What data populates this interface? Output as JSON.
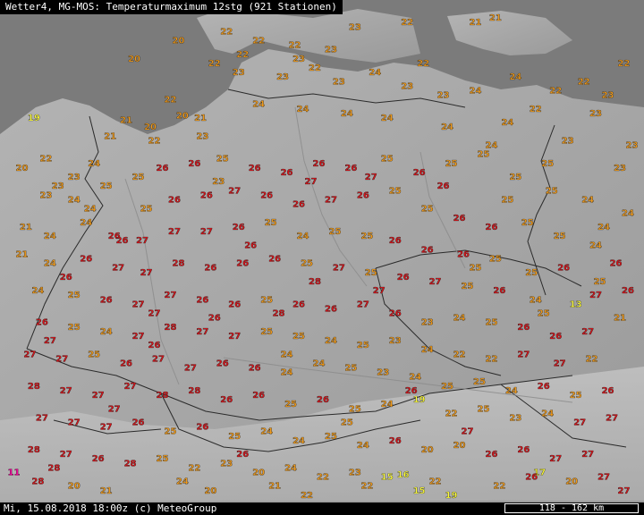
{
  "header": {
    "title": "Wetter4, MG-MOS: Temperaturmaximum 12stg (921 Stationen)"
  },
  "footer": {
    "timestamp": "Mi, 15.08.2018 18:00z (c) MeteoGroup",
    "scale": "118 - 162 km"
  },
  "colors": {
    "sea": "#7b7b7b",
    "land": "#a9a9a9",
    "border": "#2a2a2a",
    "river": "#8a8a8a",
    "temp_red": "#d8141a",
    "temp_orange": "#f09a1a",
    "temp_yellow": "#ffff3a",
    "temp_magenta": "#ff00a0"
  },
  "stations": [
    {
      "v": "20",
      "x": 8.2,
      "y": 55.3
    },
    {
      "v": "20",
      "x": 7.1,
      "y": 54.9
    },
    {
      "v": "19",
      "x": 4.6,
      "y": 53.6
    },
    {
      "v": "21",
      "x": 6.9,
      "y": 53.55
    },
    {
      "v": "20",
      "x": 7.5,
      "y": 53.4
    },
    {
      "v": "20",
      "x": 8.3,
      "y": 53.65
    },
    {
      "v": "21",
      "x": 8.75,
      "y": 53.6
    },
    {
      "v": "22",
      "x": 9.4,
      "y": 55.5
    },
    {
      "v": "22",
      "x": 10.2,
      "y": 55.3
    },
    {
      "v": "22",
      "x": 11.1,
      "y": 55.2
    },
    {
      "v": "23",
      "x": 12.0,
      "y": 55.1
    },
    {
      "v": "23",
      "x": 12.6,
      "y": 55.6
    },
    {
      "v": "22",
      "x": 13.9,
      "y": 55.7
    },
    {
      "v": "21",
      "x": 15.6,
      "y": 55.7
    },
    {
      "v": "21",
      "x": 16.1,
      "y": 55.8
    },
    {
      "v": "22",
      "x": 9.1,
      "y": 54.8
    },
    {
      "v": "23",
      "x": 9.7,
      "y": 54.6
    },
    {
      "v": "23",
      "x": 10.8,
      "y": 54.5
    },
    {
      "v": "22",
      "x": 11.6,
      "y": 54.7
    },
    {
      "v": "23",
      "x": 12.2,
      "y": 54.4
    },
    {
      "v": "24",
      "x": 13.1,
      "y": 54.6
    },
    {
      "v": "23",
      "x": 13.9,
      "y": 54.3
    },
    {
      "v": "23",
      "x": 14.8,
      "y": 54.1
    },
    {
      "v": "24",
      "x": 15.6,
      "y": 54.2
    },
    {
      "v": "24",
      "x": 16.6,
      "y": 54.5
    },
    {
      "v": "22",
      "x": 17.6,
      "y": 54.2
    },
    {
      "v": "22",
      "x": 18.3,
      "y": 54.4
    },
    {
      "v": "23",
      "x": 18.9,
      "y": 54.1
    },
    {
      "v": "22",
      "x": 19.3,
      "y": 54.8
    },
    {
      "v": "23",
      "x": 18.6,
      "y": 53.7
    },
    {
      "v": "24",
      "x": 16.4,
      "y": 53.5
    },
    {
      "v": "24",
      "x": 14.9,
      "y": 53.4
    },
    {
      "v": "24",
      "x": 13.4,
      "y": 53.6
    },
    {
      "v": "24",
      "x": 12.4,
      "y": 53.7
    },
    {
      "v": "24",
      "x": 11.3,
      "y": 53.8
    },
    {
      "v": "24",
      "x": 10.2,
      "y": 53.9
    },
    {
      "v": "23",
      "x": 8.8,
      "y": 53.2
    },
    {
      "v": "22",
      "x": 7.6,
      "y": 53.1
    },
    {
      "v": "21",
      "x": 6.5,
      "y": 53.2
    },
    {
      "v": "20",
      "x": 4.3,
      "y": 52.5
    },
    {
      "v": "22",
      "x": 4.9,
      "y": 52.7
    },
    {
      "v": "23",
      "x": 5.6,
      "y": 52.3
    },
    {
      "v": "23",
      "x": 5.2,
      "y": 52.1
    },
    {
      "v": "24",
      "x": 6.1,
      "y": 52.6
    },
    {
      "v": "23",
      "x": 4.9,
      "y": 51.9
    },
    {
      "v": "24",
      "x": 5.6,
      "y": 51.8
    },
    {
      "v": "25",
      "x": 6.4,
      "y": 52.1
    },
    {
      "v": "25",
      "x": 7.2,
      "y": 52.3
    },
    {
      "v": "26",
      "x": 7.8,
      "y": 52.5
    },
    {
      "v": "26",
      "x": 8.6,
      "y": 52.6
    },
    {
      "v": "25",
      "x": 9.3,
      "y": 52.7
    },
    {
      "v": "26",
      "x": 10.1,
      "y": 52.5
    },
    {
      "v": "26",
      "x": 10.9,
      "y": 52.4
    },
    {
      "v": "26",
      "x": 11.7,
      "y": 52.6
    },
    {
      "v": "26",
      "x": 12.5,
      "y": 52.5
    },
    {
      "v": "25",
      "x": 13.4,
      "y": 52.7
    },
    {
      "v": "26",
      "x": 14.2,
      "y": 52.4
    },
    {
      "v": "25",
      "x": 15.0,
      "y": 52.6
    },
    {
      "v": "25",
      "x": 15.8,
      "y": 52.8
    },
    {
      "v": "25",
      "x": 16.6,
      "y": 52.3
    },
    {
      "v": "25",
      "x": 17.5,
      "y": 52.0
    },
    {
      "v": "24",
      "x": 18.4,
      "y": 51.8
    },
    {
      "v": "23",
      "x": 19.2,
      "y": 52.5
    },
    {
      "v": "24",
      "x": 19.4,
      "y": 51.5
    },
    {
      "v": "25",
      "x": 7.4,
      "y": 51.6
    },
    {
      "v": "26",
      "x": 8.1,
      "y": 51.8
    },
    {
      "v": "26",
      "x": 8.9,
      "y": 51.9
    },
    {
      "v": "27",
      "x": 9.6,
      "y": 52.0
    },
    {
      "v": "26",
      "x": 10.4,
      "y": 51.9
    },
    {
      "v": "26",
      "x": 11.2,
      "y": 51.7
    },
    {
      "v": "27",
      "x": 12.0,
      "y": 51.8
    },
    {
      "v": "26",
      "x": 12.8,
      "y": 51.9
    },
    {
      "v": "25",
      "x": 13.6,
      "y": 52.0
    },
    {
      "v": "25",
      "x": 14.4,
      "y": 51.6
    },
    {
      "v": "26",
      "x": 15.2,
      "y": 51.4
    },
    {
      "v": "26",
      "x": 16.0,
      "y": 51.2
    },
    {
      "v": "25",
      "x": 16.9,
      "y": 51.3
    },
    {
      "v": "25",
      "x": 17.7,
      "y": 51.0
    },
    {
      "v": "24",
      "x": 18.6,
      "y": 50.8
    },
    {
      "v": "21",
      "x": 4.4,
      "y": 51.2
    },
    {
      "v": "24",
      "x": 5.0,
      "y": 51.0
    },
    {
      "v": "24",
      "x": 5.9,
      "y": 51.3
    },
    {
      "v": "26",
      "x": 6.6,
      "y": 51.0
    },
    {
      "v": "27",
      "x": 7.3,
      "y": 50.9
    },
    {
      "v": "27",
      "x": 8.1,
      "y": 51.1
    },
    {
      "v": "27",
      "x": 8.9,
      "y": 51.1
    },
    {
      "v": "26",
      "x": 9.7,
      "y": 51.2
    },
    {
      "v": "25",
      "x": 10.5,
      "y": 51.3
    },
    {
      "v": "24",
      "x": 11.3,
      "y": 51.0
    },
    {
      "v": "25",
      "x": 12.1,
      "y": 51.1
    },
    {
      "v": "25",
      "x": 12.9,
      "y": 51.0
    },
    {
      "v": "26",
      "x": 13.6,
      "y": 50.9
    },
    {
      "v": "26",
      "x": 14.4,
      "y": 50.7
    },
    {
      "v": "26",
      "x": 15.3,
      "y": 50.6
    },
    {
      "v": "25",
      "x": 16.1,
      "y": 50.5
    },
    {
      "v": "25",
      "x": 17.0,
      "y": 50.2
    },
    {
      "v": "26",
      "x": 17.8,
      "y": 50.3
    },
    {
      "v": "25",
      "x": 18.7,
      "y": 50.0
    },
    {
      "v": "26",
      "x": 19.4,
      "y": 49.8
    },
    {
      "v": "13",
      "x": 18.1,
      "y": 49.5
    },
    {
      "v": "21",
      "x": 4.3,
      "y": 50.6
    },
    {
      "v": "24",
      "x": 5.0,
      "y": 50.4
    },
    {
      "v": "26",
      "x": 5.9,
      "y": 50.5
    },
    {
      "v": "27",
      "x": 6.7,
      "y": 50.3
    },
    {
      "v": "27",
      "x": 7.4,
      "y": 50.2
    },
    {
      "v": "28",
      "x": 8.2,
      "y": 50.4
    },
    {
      "v": "26",
      "x": 9.0,
      "y": 50.3
    },
    {
      "v": "26",
      "x": 9.8,
      "y": 50.4
    },
    {
      "v": "26",
      "x": 10.6,
      "y": 50.5
    },
    {
      "v": "25",
      "x": 11.4,
      "y": 50.4
    },
    {
      "v": "27",
      "x": 12.2,
      "y": 50.3
    },
    {
      "v": "25",
      "x": 13.0,
      "y": 50.2
    },
    {
      "v": "26",
      "x": 13.8,
      "y": 50.1
    },
    {
      "v": "27",
      "x": 14.6,
      "y": 50.0
    },
    {
      "v": "25",
      "x": 15.4,
      "y": 49.9
    },
    {
      "v": "26",
      "x": 16.2,
      "y": 49.8
    },
    {
      "v": "24",
      "x": 17.1,
      "y": 49.6
    },
    {
      "v": "24",
      "x": 4.7,
      "y": 49.8
    },
    {
      "v": "25",
      "x": 5.6,
      "y": 49.7
    },
    {
      "v": "26",
      "x": 6.4,
      "y": 49.6
    },
    {
      "v": "27",
      "x": 7.2,
      "y": 49.5
    },
    {
      "v": "27",
      "x": 8.0,
      "y": 49.7
    },
    {
      "v": "26",
      "x": 8.8,
      "y": 49.6
    },
    {
      "v": "26",
      "x": 9.6,
      "y": 49.5
    },
    {
      "v": "25",
      "x": 10.4,
      "y": 49.6
    },
    {
      "v": "26",
      "x": 11.2,
      "y": 49.5
    },
    {
      "v": "26",
      "x": 12.0,
      "y": 49.4
    },
    {
      "v": "27",
      "x": 12.8,
      "y": 49.5
    },
    {
      "v": "26",
      "x": 13.6,
      "y": 49.3
    },
    {
      "v": "23",
      "x": 14.4,
      "y": 49.1
    },
    {
      "v": "24",
      "x": 15.2,
      "y": 49.2
    },
    {
      "v": "25",
      "x": 16.0,
      "y": 49.1
    },
    {
      "v": "26",
      "x": 16.8,
      "y": 49.0
    },
    {
      "v": "26",
      "x": 17.6,
      "y": 48.8
    },
    {
      "v": "27",
      "x": 18.4,
      "y": 48.9
    },
    {
      "v": "21",
      "x": 19.2,
      "y": 49.2
    },
    {
      "v": "26",
      "x": 4.8,
      "y": 49.1
    },
    {
      "v": "25",
      "x": 5.6,
      "y": 49.0
    },
    {
      "v": "24",
      "x": 6.4,
      "y": 48.9
    },
    {
      "v": "27",
      "x": 7.2,
      "y": 48.8
    },
    {
      "v": "28",
      "x": 8.0,
      "y": 49.0
    },
    {
      "v": "27",
      "x": 8.8,
      "y": 48.9
    },
    {
      "v": "27",
      "x": 9.6,
      "y": 48.8
    },
    {
      "v": "25",
      "x": 10.4,
      "y": 48.9
    },
    {
      "v": "25",
      "x": 11.2,
      "y": 48.8
    },
    {
      "v": "24",
      "x": 12.0,
      "y": 48.7
    },
    {
      "v": "25",
      "x": 12.8,
      "y": 48.6
    },
    {
      "v": "23",
      "x": 13.6,
      "y": 48.7
    },
    {
      "v": "24",
      "x": 14.4,
      "y": 48.5
    },
    {
      "v": "22",
      "x": 15.2,
      "y": 48.4
    },
    {
      "v": "22",
      "x": 16.0,
      "y": 48.3
    },
    {
      "v": "27",
      "x": 16.8,
      "y": 48.4
    },
    {
      "v": "27",
      "x": 17.7,
      "y": 48.2
    },
    {
      "v": "22",
      "x": 18.5,
      "y": 48.3
    },
    {
      "v": "27",
      "x": 4.5,
      "y": 48.4
    },
    {
      "v": "27",
      "x": 5.3,
      "y": 48.3
    },
    {
      "v": "25",
      "x": 6.1,
      "y": 48.4
    },
    {
      "v": "26",
      "x": 6.9,
      "y": 48.2
    },
    {
      "v": "27",
      "x": 7.7,
      "y": 48.3
    },
    {
      "v": "27",
      "x": 8.5,
      "y": 48.1
    },
    {
      "v": "26",
      "x": 9.3,
      "y": 48.2
    },
    {
      "v": "26",
      "x": 10.1,
      "y": 48.1
    },
    {
      "v": "24",
      "x": 10.9,
      "y": 48.0
    },
    {
      "v": "24",
      "x": 11.7,
      "y": 48.2
    },
    {
      "v": "25",
      "x": 12.5,
      "y": 48.1
    },
    {
      "v": "23",
      "x": 13.3,
      "y": 48.0
    },
    {
      "v": "24",
      "x": 14.1,
      "y": 47.9
    },
    {
      "v": "25",
      "x": 14.9,
      "y": 47.7
    },
    {
      "v": "25",
      "x": 15.7,
      "y": 47.8
    },
    {
      "v": "24",
      "x": 16.5,
      "y": 47.6
    },
    {
      "v": "26",
      "x": 17.3,
      "y": 47.7
    },
    {
      "v": "25",
      "x": 18.1,
      "y": 47.5
    },
    {
      "v": "26",
      "x": 18.9,
      "y": 47.6
    },
    {
      "v": "28",
      "x": 4.6,
      "y": 47.7
    },
    {
      "v": "27",
      "x": 5.4,
      "y": 47.6
    },
    {
      "v": "27",
      "x": 6.2,
      "y": 47.5
    },
    {
      "v": "27",
      "x": 7.0,
      "y": 47.7
    },
    {
      "v": "28",
      "x": 7.8,
      "y": 47.5
    },
    {
      "v": "28",
      "x": 8.6,
      "y": 47.6
    },
    {
      "v": "26",
      "x": 9.4,
      "y": 47.4
    },
    {
      "v": "26",
      "x": 10.2,
      "y": 47.5
    },
    {
      "v": "25",
      "x": 11.0,
      "y": 47.3
    },
    {
      "v": "26",
      "x": 11.8,
      "y": 47.4
    },
    {
      "v": "25",
      "x": 12.6,
      "y": 47.2
    },
    {
      "v": "24",
      "x": 13.4,
      "y": 47.3
    },
    {
      "v": "19",
      "x": 14.2,
      "y": 47.4
    },
    {
      "v": "22",
      "x": 15.0,
      "y": 47.1
    },
    {
      "v": "25",
      "x": 15.8,
      "y": 47.2
    },
    {
      "v": "23",
      "x": 16.6,
      "y": 47.0
    },
    {
      "v": "24",
      "x": 17.4,
      "y": 47.1
    },
    {
      "v": "27",
      "x": 18.2,
      "y": 46.9
    },
    {
      "v": "27",
      "x": 19.0,
      "y": 47.0
    },
    {
      "v": "27",
      "x": 4.8,
      "y": 47.0
    },
    {
      "v": "27",
      "x": 5.6,
      "y": 46.9
    },
    {
      "v": "27",
      "x": 6.4,
      "y": 46.8
    },
    {
      "v": "26",
      "x": 7.2,
      "y": 46.9
    },
    {
      "v": "25",
      "x": 8.0,
      "y": 46.7
    },
    {
      "v": "26",
      "x": 8.8,
      "y": 46.8
    },
    {
      "v": "25",
      "x": 9.6,
      "y": 46.6
    },
    {
      "v": "24",
      "x": 10.4,
      "y": 46.7
    },
    {
      "v": "24",
      "x": 11.2,
      "y": 46.5
    },
    {
      "v": "25",
      "x": 12.0,
      "y": 46.6
    },
    {
      "v": "24",
      "x": 12.8,
      "y": 46.4
    },
    {
      "v": "26",
      "x": 13.6,
      "y": 46.5
    },
    {
      "v": "20",
      "x": 14.4,
      "y": 46.3
    },
    {
      "v": "20",
      "x": 15.2,
      "y": 46.4
    },
    {
      "v": "26",
      "x": 16.0,
      "y": 46.2
    },
    {
      "v": "26",
      "x": 16.8,
      "y": 46.3
    },
    {
      "v": "27",
      "x": 17.6,
      "y": 46.1
    },
    {
      "v": "27",
      "x": 18.4,
      "y": 46.2
    },
    {
      "v": "28",
      "x": 4.6,
      "y": 46.3
    },
    {
      "v": "27",
      "x": 5.4,
      "y": 46.2
    },
    {
      "v": "26",
      "x": 6.2,
      "y": 46.1
    },
    {
      "v": "28",
      "x": 7.0,
      "y": 46.0
    },
    {
      "v": "25",
      "x": 7.8,
      "y": 46.1
    },
    {
      "v": "22",
      "x": 8.6,
      "y": 45.9
    },
    {
      "v": "23",
      "x": 9.4,
      "y": 46.0
    },
    {
      "v": "20",
      "x": 10.2,
      "y": 45.8
    },
    {
      "v": "24",
      "x": 11.0,
      "y": 45.9
    },
    {
      "v": "22",
      "x": 11.8,
      "y": 45.7
    },
    {
      "v": "23",
      "x": 12.6,
      "y": 45.8
    },
    {
      "v": "15",
      "x": 13.4,
      "y": 45.7
    },
    {
      "v": "16",
      "x": 13.8,
      "y": 45.75
    },
    {
      "v": "22",
      "x": 14.6,
      "y": 45.6
    },
    {
      "v": "17",
      "x": 17.2,
      "y": 45.8
    },
    {
      "v": "20",
      "x": 18.0,
      "y": 45.6
    },
    {
      "v": "27",
      "x": 18.8,
      "y": 45.7
    },
    {
      "v": "11",
      "x": 4.1,
      "y": 45.8
    },
    {
      "v": "28",
      "x": 4.7,
      "y": 45.6
    },
    {
      "v": "20",
      "x": 5.6,
      "y": 45.5
    },
    {
      "v": "21",
      "x": 6.4,
      "y": 45.4
    },
    {
      "v": "20",
      "x": 9.0,
      "y": 45.4
    },
    {
      "v": "21",
      "x": 10.6,
      "y": 45.5
    },
    {
      "v": "22",
      "x": 11.4,
      "y": 45.3
    },
    {
      "v": "15",
      "x": 14.2,
      "y": 45.4
    },
    {
      "v": "19",
      "x": 15.0,
      "y": 45.3
    },
    {
      "v": "22",
      "x": 16.2,
      "y": 45.5
    },
    {
      "v": "27",
      "x": 19.3,
      "y": 45.4
    },
    {
      "v": "26",
      "x": 6.8,
      "y": 50.9
    },
    {
      "v": "26",
      "x": 10.0,
      "y": 50.8
    },
    {
      "v": "28",
      "x": 11.6,
      "y": 50.0
    },
    {
      "v": "27",
      "x": 13.2,
      "y": 49.8
    },
    {
      "v": "26",
      "x": 9.1,
      "y": 49.2
    },
    {
      "v": "28",
      "x": 10.7,
      "y": 49.3
    },
    {
      "v": "27",
      "x": 7.6,
      "y": 49.3
    },
    {
      "v": "23",
      "x": 9.2,
      "y": 52.2
    },
    {
      "v": "27",
      "x": 11.5,
      "y": 52.2
    },
    {
      "v": "27",
      "x": 13.0,
      "y": 52.3
    },
    {
      "v": "26",
      "x": 14.8,
      "y": 52.1
    },
    {
      "v": "25",
      "x": 16.4,
      "y": 51.8
    },
    {
      "v": "22",
      "x": 8.0,
      "y": 54.0
    },
    {
      "v": "22",
      "x": 9.8,
      "y": 55.0
    },
    {
      "v": "23",
      "x": 11.2,
      "y": 54.9
    },
    {
      "v": "22",
      "x": 14.3,
      "y": 54.8
    },
    {
      "v": "24",
      "x": 16.0,
      "y": 53.0
    },
    {
      "v": "23",
      "x": 17.9,
      "y": 53.1
    },
    {
      "v": "24",
      "x": 6.0,
      "y": 51.6
    },
    {
      "v": "26",
      "x": 5.4,
      "y": 50.1
    },
    {
      "v": "25",
      "x": 15.6,
      "y": 50.3
    },
    {
      "v": "25",
      "x": 17.3,
      "y": 49.3
    },
    {
      "v": "24",
      "x": 10.9,
      "y": 48.4
    },
    {
      "v": "26",
      "x": 7.6,
      "y": 48.6
    },
    {
      "v": "27",
      "x": 5.0,
      "y": 48.7
    },
    {
      "v": "26",
      "x": 14.0,
      "y": 47.6
    },
    {
      "v": "27",
      "x": 6.6,
      "y": 47.2
    },
    {
      "v": "25",
      "x": 12.4,
      "y": 46.9
    },
    {
      "v": "27",
      "x": 15.4,
      "y": 46.7
    },
    {
      "v": "26",
      "x": 9.8,
      "y": 46.2
    },
    {
      "v": "26",
      "x": 17.0,
      "y": 45.7
    },
    {
      "v": "24",
      "x": 8.3,
      "y": 45.6
    },
    {
      "v": "22",
      "x": 12.9,
      "y": 45.5
    },
    {
      "v": "28",
      "x": 5.1,
      "y": 45.9
    },
    {
      "v": "24",
      "x": 18.8,
      "y": 51.2
    },
    {
      "v": "25",
      "x": 17.4,
      "y": 52.6
    },
    {
      "v": "23",
      "x": 19.5,
      "y": 53.0
    },
    {
      "v": "22",
      "x": 17.1,
      "y": 53.8
    },
    {
      "v": "26",
      "x": 19.1,
      "y": 50.4
    },
    {
      "v": "27",
      "x": 18.6,
      "y": 49.7
    }
  ]
}
